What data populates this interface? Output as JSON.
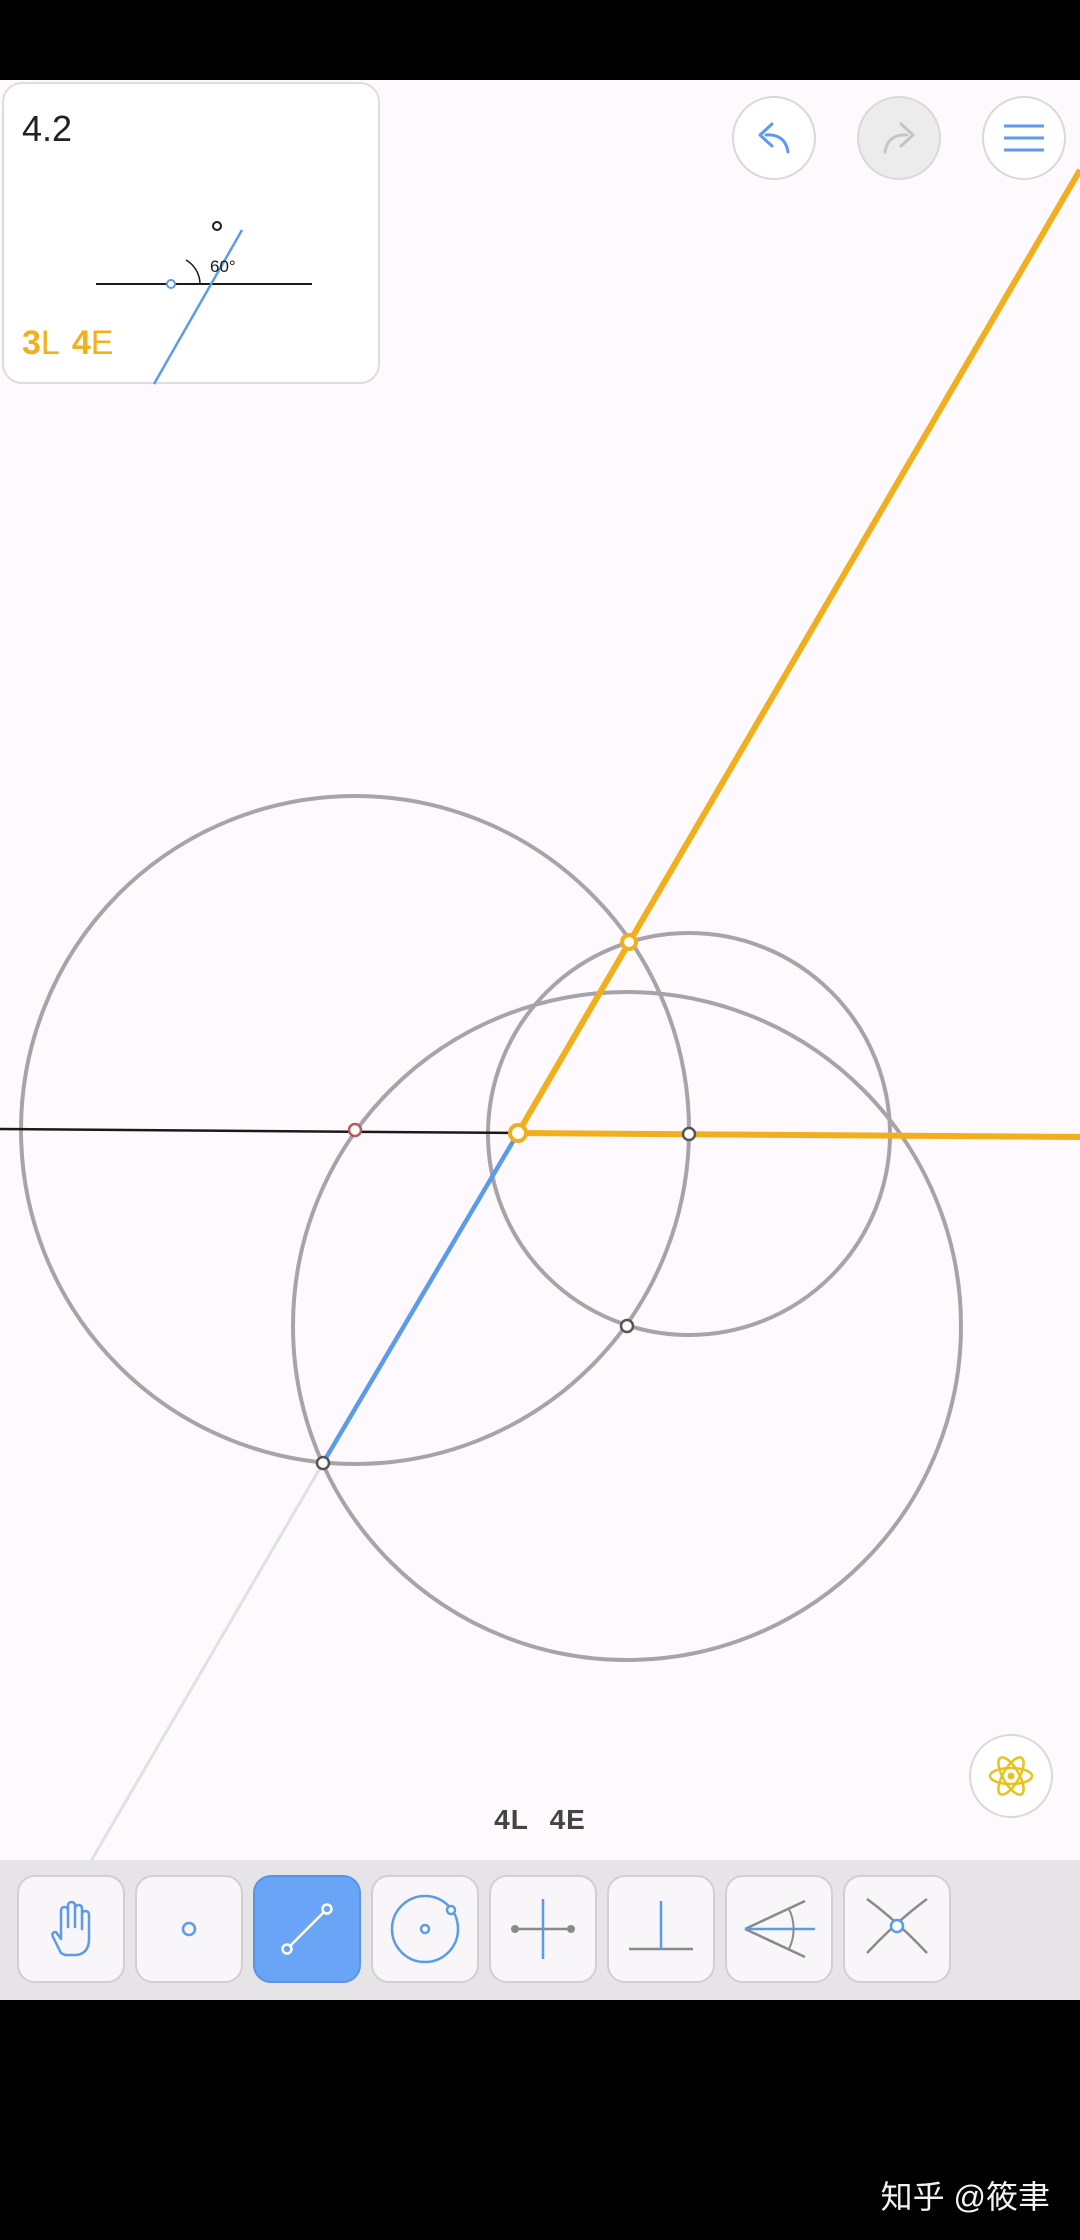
{
  "goal": {
    "title": "4.2",
    "angle_label": "60°",
    "score": {
      "lines_value": "3",
      "lines_letter": "L",
      "elements_value": "4",
      "elements_letter": "E"
    }
  },
  "header": {
    "undo_icon": "undo-arrow-icon",
    "redo_icon": "redo-arrow-icon",
    "menu_icon": "hamburger-menu-icon",
    "redo_enabled": false
  },
  "hint": {
    "icon": "atom-icon",
    "color": "#e8c21a"
  },
  "counter": {
    "lines": "4L",
    "elements": "4E"
  },
  "toolbar": {
    "tools": [
      {
        "name": "move",
        "icon": "hand-icon",
        "active": false
      },
      {
        "name": "point",
        "icon": "point-icon",
        "active": false
      },
      {
        "name": "line",
        "icon": "line-icon",
        "active": true
      },
      {
        "name": "circle",
        "icon": "circle-icon",
        "active": false
      },
      {
        "name": "perpendicular-bisector",
        "icon": "perpendicular-bisector-icon",
        "active": false
      },
      {
        "name": "perpendicular",
        "icon": "perpendicular-icon",
        "active": false
      },
      {
        "name": "angle-bisector",
        "icon": "angle-bisector-icon",
        "active": false
      },
      {
        "name": "intersect",
        "icon": "intersection-icon",
        "active": false
      }
    ]
  },
  "colors": {
    "accent_blue": "#5b9bea",
    "solution_yellow": "#f2ae1c",
    "circle_gray": "#a8a3a8",
    "background": "#fdf9fc"
  },
  "watermark": "知乎 @筱聿"
}
